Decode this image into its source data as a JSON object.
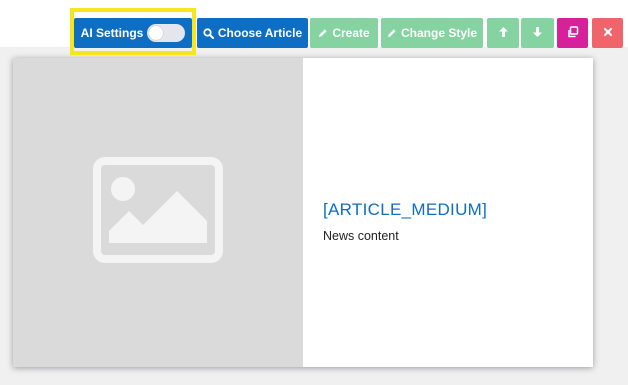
{
  "toolbar": {
    "ai_settings_label": "AI Settings",
    "ai_settings_enabled": false,
    "choose_article_label": "Choose Article",
    "create_label": "Create",
    "change_style_label": "Change Style",
    "icons": {
      "choose_article": "search-icon",
      "create": "pencil-icon",
      "change_style": "pencil-icon",
      "move_up": "arrow-up-icon",
      "move_down": "arrow-down-icon",
      "copy": "copy-icon",
      "delete": "close-icon"
    }
  },
  "article": {
    "title": "[ARTICLE_MEDIUM]",
    "description": "News content",
    "image": "image-placeholder-icon"
  },
  "colors": {
    "primary_blue": "#0d6ec4",
    "green_disabled": "#84d3a1",
    "copy_magenta": "#d6219b",
    "delete_red": "#f0646c",
    "highlight_yellow": "#f6e61c",
    "image_bg": "#dadada"
  }
}
